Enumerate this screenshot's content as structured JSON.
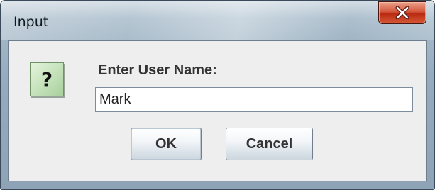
{
  "window": {
    "title": "Input",
    "close_icon": "close-x-icon"
  },
  "dialog": {
    "icon": "question-icon",
    "icon_glyph": "?",
    "prompt": "Enter User Name:",
    "input_value": "Mark"
  },
  "buttons": {
    "ok_label": "OK",
    "cancel_label": "Cancel"
  },
  "colors": {
    "close_button": "#c8422a",
    "icon_background": "#c6e3bc",
    "client_background": "#eeeeee"
  }
}
